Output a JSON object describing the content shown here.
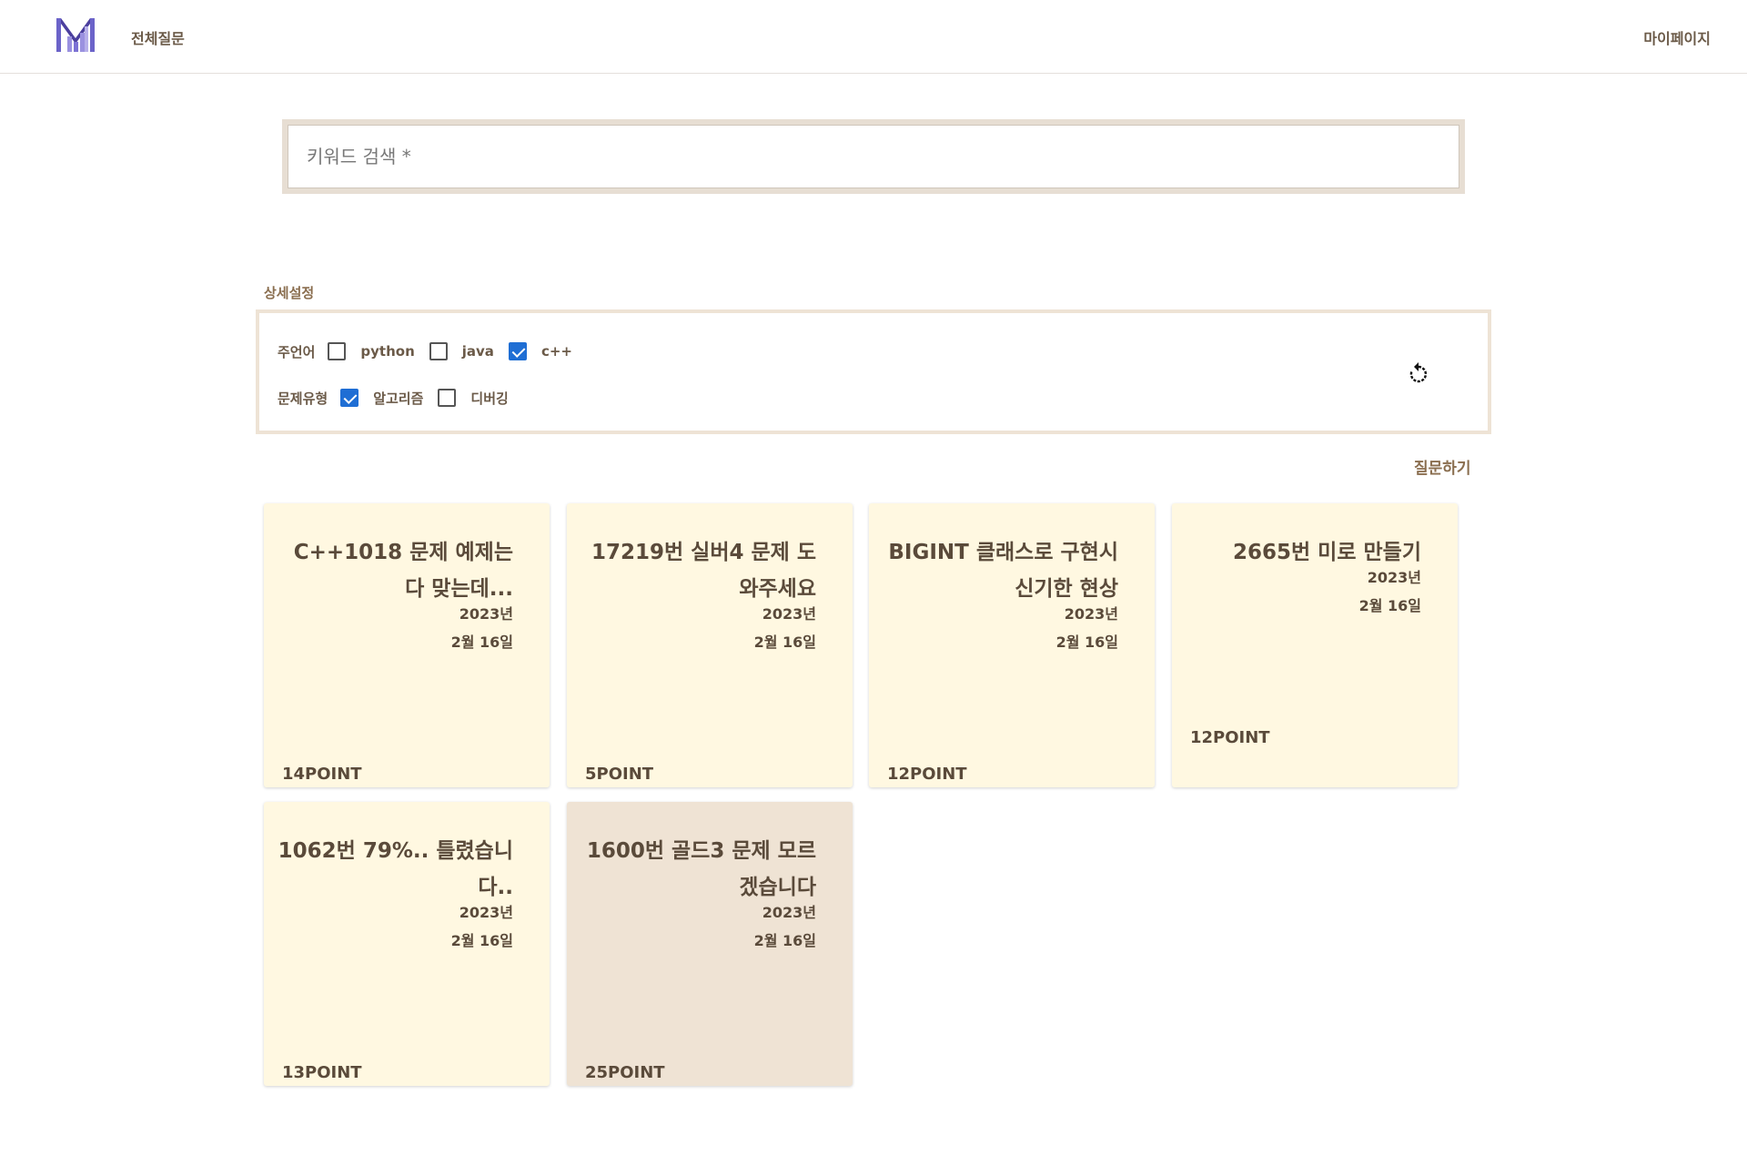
{
  "header": {
    "nav_all": "전체질문",
    "nav_mypage": "마이페이지"
  },
  "search": {
    "placeholder": "키워드 검색 *",
    "value": ""
  },
  "advanced": {
    "label": "상세설정",
    "language": {
      "title": "주언어",
      "options": [
        {
          "label": "python",
          "checked": false
        },
        {
          "label": "java",
          "checked": false
        },
        {
          "label": "c++",
          "checked": true
        }
      ]
    },
    "problem_type": {
      "title": "문제유형",
      "options": [
        {
          "label": "알고리즘",
          "checked": true
        },
        {
          "label": "디버깅",
          "checked": false
        }
      ]
    }
  },
  "ask_button": "질문하기",
  "cards": [
    {
      "title": "C++1018 문제 예제는 다 맞는데...",
      "year": "2023년",
      "date": "2월 16일",
      "point": "14POINT"
    },
    {
      "title": "17219번 실버4 문제 도와주세요",
      "year": "2023년",
      "date": "2월 16일",
      "point": "5POINT"
    },
    {
      "title": "BIGINT 클래스로 구현시 신기한 현상",
      "year": "2023년",
      "date": "2월 16일",
      "point": "12POINT"
    },
    {
      "title": "2665번 미로 만들기",
      "year": "2023년",
      "date": "2월 16일",
      "point": "12POINT"
    },
    {
      "title": "1062번 79%.. 틀렸습니다..",
      "year": "2023년",
      "date": "2월 16일",
      "point": "13POINT"
    },
    {
      "title": "1600번 골드3 문제 모르겠습니다",
      "year": "2023년",
      "date": "2월 16일",
      "point": "25POINT"
    }
  ],
  "colors": {
    "card_bg": "#fff8e1",
    "card_alt_bg": "#efe3d4",
    "checkbox_checked": "#1f6ed4",
    "accent_text": "#8a6e4f"
  }
}
